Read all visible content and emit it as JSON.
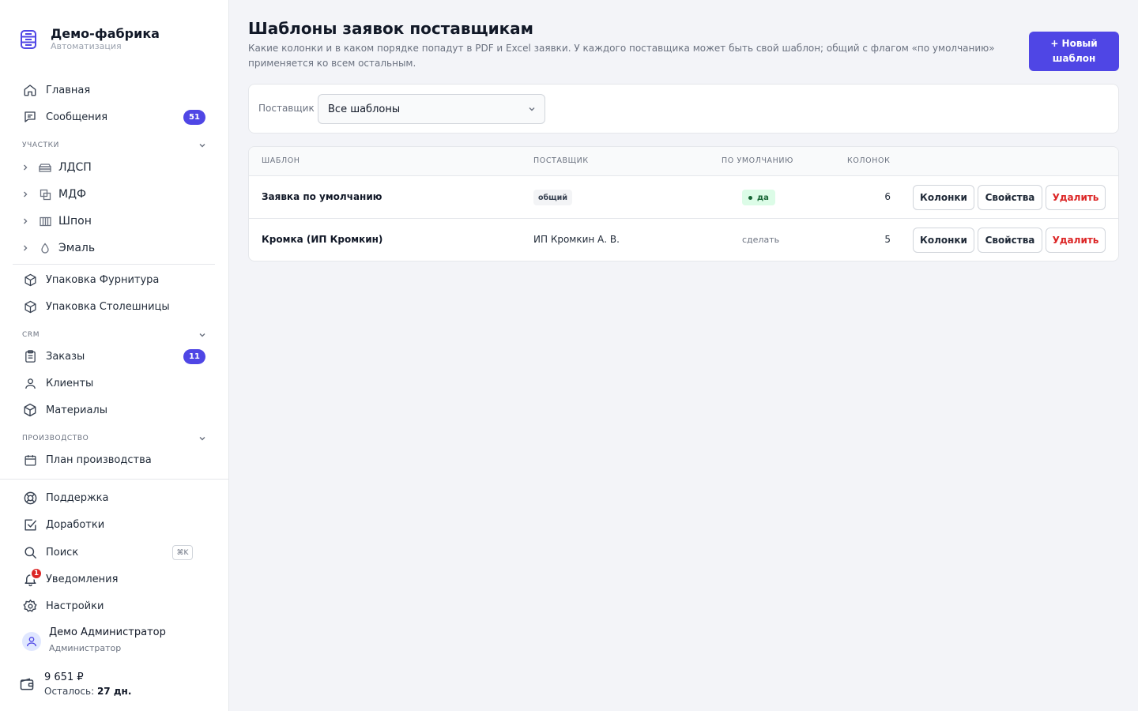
{
  "brand": {
    "title": "Демо-фабрика",
    "subtitle": "Автоматизация"
  },
  "nav": {
    "home": "Главная",
    "messages": {
      "label": "Сообщения",
      "badge": "51"
    }
  },
  "sections": {
    "areas": "УЧАСТКИ",
    "crm": "CRM",
    "production": "ПРОИЗВОДСТВО"
  },
  "areas": [
    "ЛДСП",
    "МДФ",
    "Шпон",
    "Эмаль"
  ],
  "packaging": [
    "Упаковка Фурнитура",
    "Упаковка Столешницы"
  ],
  "crm": {
    "orders": {
      "label": "Заказы",
      "badge": "11"
    },
    "clients": "Клиенты",
    "materials": "Материалы"
  },
  "production": {
    "plan": "План производства"
  },
  "bottom_nav": {
    "support": "Поддержка",
    "improvements": "Доработки",
    "search": "Поиск",
    "search_shortcut": "⌘K",
    "notifications": "Уведомления",
    "notifications_count": "1",
    "settings": "Настройки"
  },
  "user": {
    "name": "Демо Администратор",
    "role": "Администратор"
  },
  "balance": {
    "amount": "9 651 ₽",
    "remaining_label": "Осталось:",
    "remaining_value": "27 дн."
  },
  "page": {
    "title": "Шаблоны заявок поставщикам",
    "description": "Какие колонки и в каком порядке попадут в PDF и Excel заявки. У каждого поставщика может быть свой шаблон; общий с флагом «по умолчанию» применяется ко всем остальным.",
    "new_button": "+ Новый шаблон"
  },
  "filter": {
    "label": "Поставщик",
    "value": "Все шаблоны"
  },
  "table": {
    "headers": {
      "template": "ШАБЛОН",
      "supplier": "ПОСТАВЩИК",
      "default": "ПО УМОЛЧАНИЮ",
      "columns": "КОЛОНОК"
    },
    "rows": [
      {
        "name": "Заявка по умолчанию",
        "supplier": "общий",
        "default": "да",
        "columns": "6"
      },
      {
        "name": "Кромка (ИП Кромкин)",
        "supplier": "ИП Кромкин А. В.",
        "default": "сделать",
        "columns": "5"
      }
    ],
    "actions": {
      "columns": "Колонки",
      "properties": "Свойства",
      "delete": "Удалить"
    }
  },
  "colors": {
    "accent": "#4f46e5",
    "danger": "#dc2626",
    "success_bg": "#dcfce7",
    "success_text": "#166534"
  }
}
